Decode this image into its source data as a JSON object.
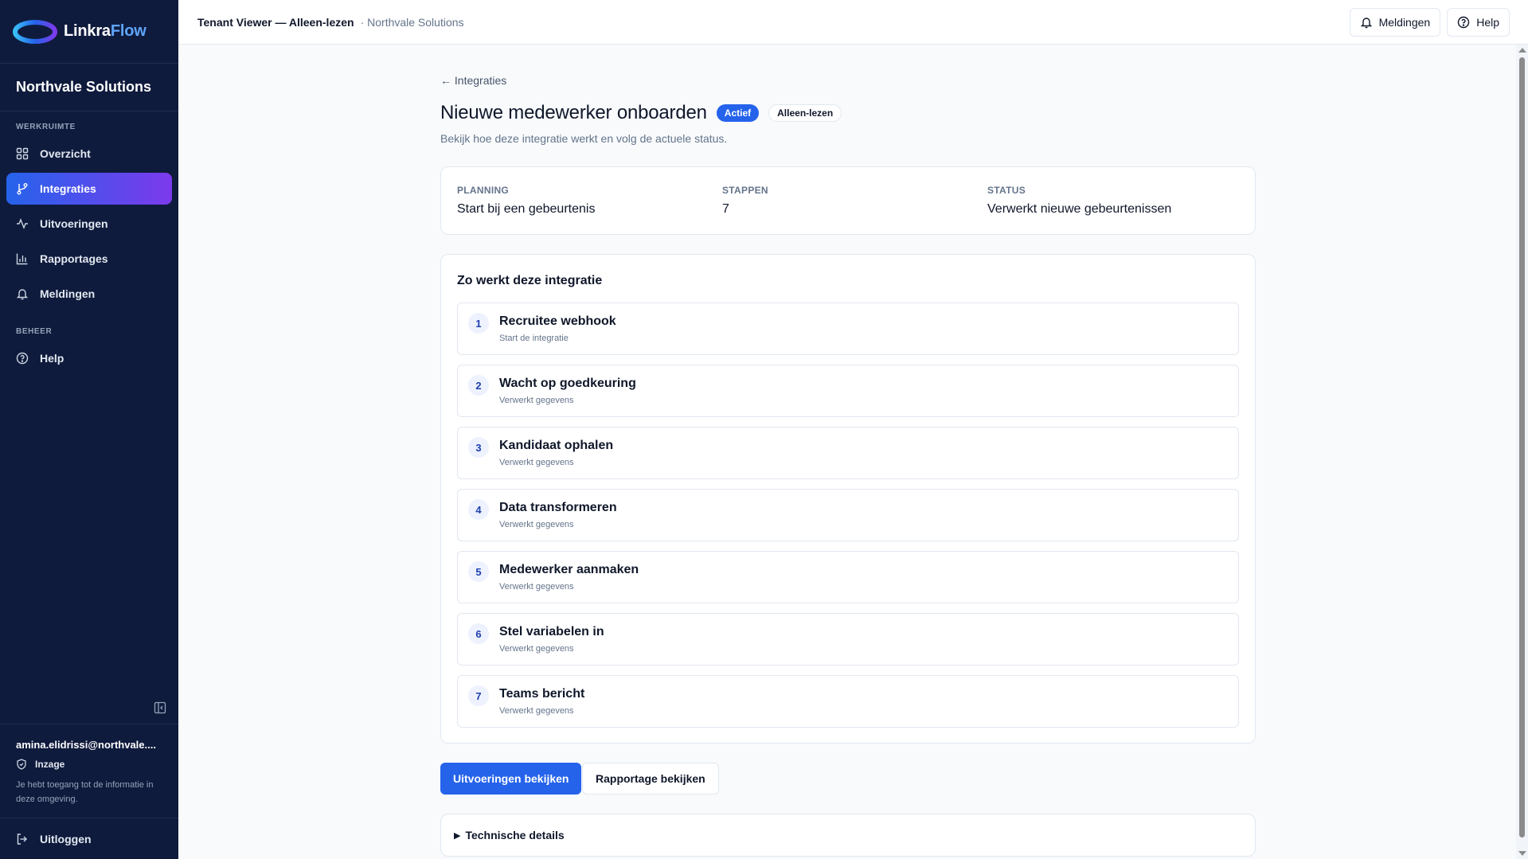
{
  "brand": {
    "name_main": "Linkra",
    "name_accent": "Flow"
  },
  "tenant_name": "Northvale Solutions",
  "sidebar": {
    "section_workspace": "WERKRUIMTE",
    "section_admin": "BEHEER",
    "items": [
      {
        "label": "Overzicht",
        "icon": "grid-icon",
        "active": false
      },
      {
        "label": "Integraties",
        "icon": "git-branch-icon",
        "active": true
      },
      {
        "label": "Uitvoeringen",
        "icon": "activity-icon",
        "active": false
      },
      {
        "label": "Rapportages",
        "icon": "bar-chart-icon",
        "active": false
      },
      {
        "label": "Meldingen",
        "icon": "bell-icon",
        "active": false
      }
    ],
    "admin_items": [
      {
        "label": "Help",
        "icon": "help-circle-icon"
      }
    ],
    "user_email": "amina.elidrissi@northvale....",
    "role": "Inzage",
    "access_note": "Je hebt toegang tot de informatie in deze omgeving.",
    "logout_label": "Uitloggen"
  },
  "topbar": {
    "title": "Tenant Viewer — Alleen-lezen",
    "subtitle": "· Northvale Solutions",
    "notifications_label": "Meldingen",
    "help_label": "Help"
  },
  "page": {
    "back_link": "← Integraties",
    "title": "Nieuwe medewerker onboarden",
    "badge_status": "Actief",
    "badge_mode": "Alleen-lezen",
    "subtitle": "Bekijk hoe deze integratie werkt en volg de actuele status."
  },
  "summary": {
    "planning_label": "PLANNING",
    "planning_value": "Start bij een gebeurtenis",
    "steps_label": "STAPPEN",
    "steps_value": "7",
    "status_label": "STATUS",
    "status_value": "Verwerkt nieuwe gebeurtenissen"
  },
  "steps_section": {
    "title": "Zo werkt deze integratie",
    "steps": [
      {
        "number": "1",
        "name": "Recruitee webhook",
        "description": "Start de integratie"
      },
      {
        "number": "2",
        "name": "Wacht op goedkeuring",
        "description": "Verwerkt gegevens"
      },
      {
        "number": "3",
        "name": "Kandidaat ophalen",
        "description": "Verwerkt gegevens"
      },
      {
        "number": "4",
        "name": "Data transformeren",
        "description": "Verwerkt gegevens"
      },
      {
        "number": "5",
        "name": "Medewerker aanmaken",
        "description": "Verwerkt gegevens"
      },
      {
        "number": "6",
        "name": "Stel variabelen in",
        "description": "Verwerkt gegevens"
      },
      {
        "number": "7",
        "name": "Teams bericht",
        "description": "Verwerkt gegevens"
      }
    ]
  },
  "actions": {
    "primary_label": "Uitvoeringen bekijken",
    "secondary_label": "Rapportage bekijken"
  },
  "tech_details_label": "Technische details",
  "colors": {
    "sidebar_bg": "#0f1b3d",
    "accent_blue": "#2563eb",
    "accent_purple": "#7c3aed",
    "brand_accent": "#60a5fa"
  }
}
